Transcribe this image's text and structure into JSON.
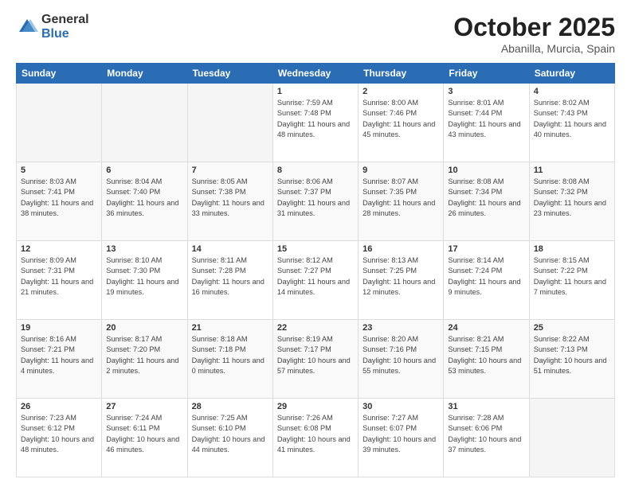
{
  "logo": {
    "general": "General",
    "blue": "Blue"
  },
  "title": {
    "month": "October 2025",
    "location": "Abanilla, Murcia, Spain"
  },
  "weekdays": [
    "Sunday",
    "Monday",
    "Tuesday",
    "Wednesday",
    "Thursday",
    "Friday",
    "Saturday"
  ],
  "weeks": [
    [
      {
        "day": "",
        "info": ""
      },
      {
        "day": "",
        "info": ""
      },
      {
        "day": "",
        "info": ""
      },
      {
        "day": "1",
        "info": "Sunrise: 7:59 AM\nSunset: 7:48 PM\nDaylight: 11 hours and 48 minutes."
      },
      {
        "day": "2",
        "info": "Sunrise: 8:00 AM\nSunset: 7:46 PM\nDaylight: 11 hours and 45 minutes."
      },
      {
        "day": "3",
        "info": "Sunrise: 8:01 AM\nSunset: 7:44 PM\nDaylight: 11 hours and 43 minutes."
      },
      {
        "day": "4",
        "info": "Sunrise: 8:02 AM\nSunset: 7:43 PM\nDaylight: 11 hours and 40 minutes."
      }
    ],
    [
      {
        "day": "5",
        "info": "Sunrise: 8:03 AM\nSunset: 7:41 PM\nDaylight: 11 hours and 38 minutes."
      },
      {
        "day": "6",
        "info": "Sunrise: 8:04 AM\nSunset: 7:40 PM\nDaylight: 11 hours and 36 minutes."
      },
      {
        "day": "7",
        "info": "Sunrise: 8:05 AM\nSunset: 7:38 PM\nDaylight: 11 hours and 33 minutes."
      },
      {
        "day": "8",
        "info": "Sunrise: 8:06 AM\nSunset: 7:37 PM\nDaylight: 11 hours and 31 minutes."
      },
      {
        "day": "9",
        "info": "Sunrise: 8:07 AM\nSunset: 7:35 PM\nDaylight: 11 hours and 28 minutes."
      },
      {
        "day": "10",
        "info": "Sunrise: 8:08 AM\nSunset: 7:34 PM\nDaylight: 11 hours and 26 minutes."
      },
      {
        "day": "11",
        "info": "Sunrise: 8:08 AM\nSunset: 7:32 PM\nDaylight: 11 hours and 23 minutes."
      }
    ],
    [
      {
        "day": "12",
        "info": "Sunrise: 8:09 AM\nSunset: 7:31 PM\nDaylight: 11 hours and 21 minutes."
      },
      {
        "day": "13",
        "info": "Sunrise: 8:10 AM\nSunset: 7:30 PM\nDaylight: 11 hours and 19 minutes."
      },
      {
        "day": "14",
        "info": "Sunrise: 8:11 AM\nSunset: 7:28 PM\nDaylight: 11 hours and 16 minutes."
      },
      {
        "day": "15",
        "info": "Sunrise: 8:12 AM\nSunset: 7:27 PM\nDaylight: 11 hours and 14 minutes."
      },
      {
        "day": "16",
        "info": "Sunrise: 8:13 AM\nSunset: 7:25 PM\nDaylight: 11 hours and 12 minutes."
      },
      {
        "day": "17",
        "info": "Sunrise: 8:14 AM\nSunset: 7:24 PM\nDaylight: 11 hours and 9 minutes."
      },
      {
        "day": "18",
        "info": "Sunrise: 8:15 AM\nSunset: 7:22 PM\nDaylight: 11 hours and 7 minutes."
      }
    ],
    [
      {
        "day": "19",
        "info": "Sunrise: 8:16 AM\nSunset: 7:21 PM\nDaylight: 11 hours and 4 minutes."
      },
      {
        "day": "20",
        "info": "Sunrise: 8:17 AM\nSunset: 7:20 PM\nDaylight: 11 hours and 2 minutes."
      },
      {
        "day": "21",
        "info": "Sunrise: 8:18 AM\nSunset: 7:18 PM\nDaylight: 11 hours and 0 minutes."
      },
      {
        "day": "22",
        "info": "Sunrise: 8:19 AM\nSunset: 7:17 PM\nDaylight: 10 hours and 57 minutes."
      },
      {
        "day": "23",
        "info": "Sunrise: 8:20 AM\nSunset: 7:16 PM\nDaylight: 10 hours and 55 minutes."
      },
      {
        "day": "24",
        "info": "Sunrise: 8:21 AM\nSunset: 7:15 PM\nDaylight: 10 hours and 53 minutes."
      },
      {
        "day": "25",
        "info": "Sunrise: 8:22 AM\nSunset: 7:13 PM\nDaylight: 10 hours and 51 minutes."
      }
    ],
    [
      {
        "day": "26",
        "info": "Sunrise: 7:23 AM\nSunset: 6:12 PM\nDaylight: 10 hours and 48 minutes."
      },
      {
        "day": "27",
        "info": "Sunrise: 7:24 AM\nSunset: 6:11 PM\nDaylight: 10 hours and 46 minutes."
      },
      {
        "day": "28",
        "info": "Sunrise: 7:25 AM\nSunset: 6:10 PM\nDaylight: 10 hours and 44 minutes."
      },
      {
        "day": "29",
        "info": "Sunrise: 7:26 AM\nSunset: 6:08 PM\nDaylight: 10 hours and 41 minutes."
      },
      {
        "day": "30",
        "info": "Sunrise: 7:27 AM\nSunset: 6:07 PM\nDaylight: 10 hours and 39 minutes."
      },
      {
        "day": "31",
        "info": "Sunrise: 7:28 AM\nSunset: 6:06 PM\nDaylight: 10 hours and 37 minutes."
      },
      {
        "day": "",
        "info": ""
      }
    ]
  ]
}
